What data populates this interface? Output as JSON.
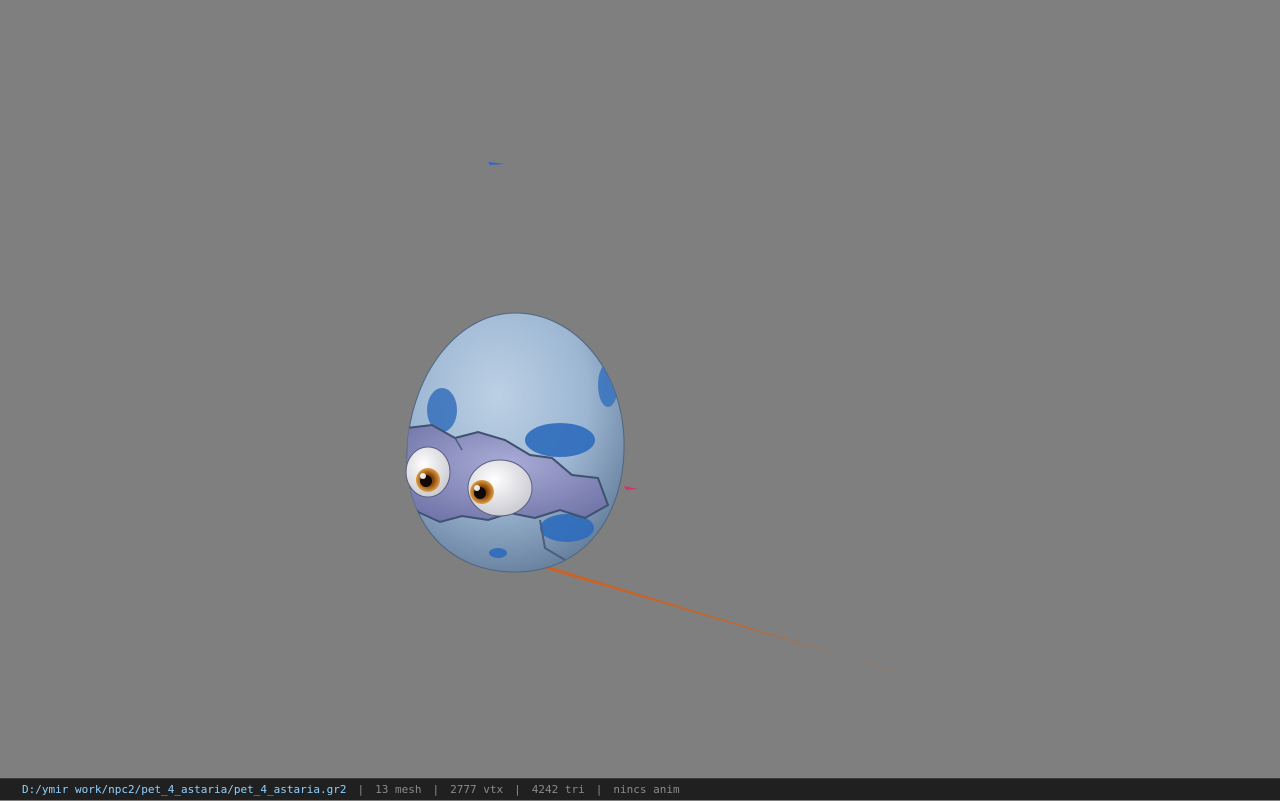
{
  "viewport": {
    "background_color": "#7f7f7f",
    "model": "egg-pet-with-eyes"
  },
  "status_bar": {
    "file_path": "D:/ymir work/npc2/pet_4_astaria/pet_4_astaria.gr2",
    "separator": "|",
    "mesh_count": "13 mesh",
    "vertex_count": "2777 vtx",
    "triangle_count": "4242 tri",
    "animation": "nincs anim",
    "path_color": "#8fd0ff",
    "text_color": "#8a8a8a"
  }
}
